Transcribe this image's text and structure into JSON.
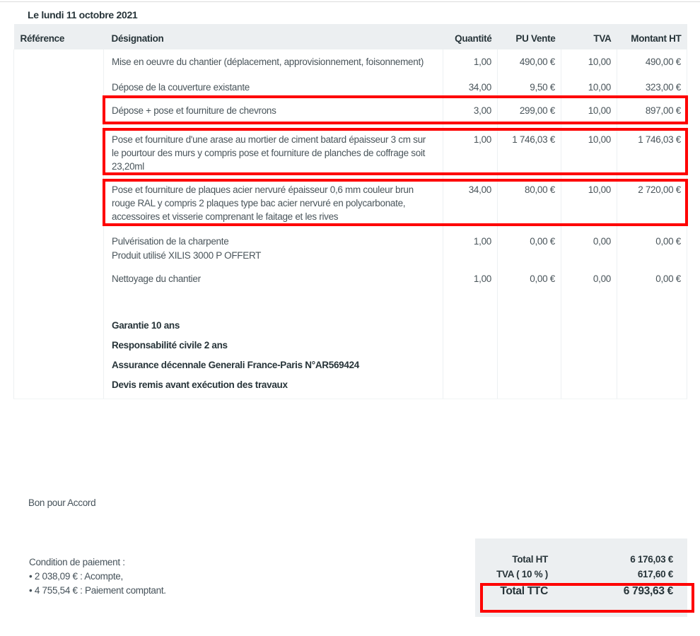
{
  "date_line": "Le lundi 11 octobre 2021",
  "highlight_color": "#ff0000",
  "table": {
    "headers": [
      "Référence",
      "Désignation",
      "Quantité",
      "PU Vente",
      "TVA",
      "Montant HT"
    ],
    "rows": [
      {
        "reference": "",
        "designation_lines": [
          "Mise en oeuvre du chantier (déplacement, approvisionnement, foisonnement)"
        ],
        "quantity": "1,00",
        "unit_price": "490,00 €",
        "tva": "10,00",
        "amount": "490,00 €",
        "highlighted": false
      },
      {
        "reference": "",
        "designation_lines": [
          "Dépose de la couverture existante"
        ],
        "quantity": "34,00",
        "unit_price": "9,50 €",
        "tva": "10,00",
        "amount": "323,00 €",
        "highlighted": false
      },
      {
        "reference": "",
        "designation_lines": [
          "Dépose + pose et fourniture de chevrons"
        ],
        "quantity": "3,00",
        "unit_price": "299,00 €",
        "tva": "10,00",
        "amount": "897,00 €",
        "highlighted": true
      },
      {
        "reference": "",
        "designation_lines": [
          "Pose et fourniture d'une arase au mortier de ciment batard épaisseur 3 cm sur",
          "le pourtour des murs y compris pose et fourniture de planches de coffrage soit",
          "23,20ml"
        ],
        "quantity": "1,00",
        "unit_price": "1 746,03 €",
        "tva": "10,00",
        "amount": "1 746,03 €",
        "highlighted": true
      },
      {
        "reference": "",
        "designation_lines": [
          "Pose et fourniture de plaques acier nervuré épaisseur 0,6 mm couleur brun",
          "rouge RAL y compris 2 plaques type bac acier nervuré en polycarbonate,",
          "accessoires et visserie comprenant le faitage et les rives"
        ],
        "quantity": "34,00",
        "unit_price": "80,00 €",
        "tva": "10,00",
        "amount": "2 720,00 €",
        "highlighted": true
      },
      {
        "reference": "",
        "designation_lines": [
          "Pulvérisation de la charpente",
          "Produit utilisé XILIS 3000 P OFFERT"
        ],
        "quantity": "1,00",
        "unit_price": "0,00 €",
        "tva": "0,00",
        "amount": "0,00 €",
        "highlighted": false
      },
      {
        "reference": "",
        "designation_lines": [
          "Nettoyage du chantier"
        ],
        "quantity": "1,00",
        "unit_price": "0,00 €",
        "tva": "0,00",
        "amount": "0,00 €",
        "highlighted": false
      }
    ],
    "notes": [
      "Garantie 10 ans",
      "Responsabilité civile 2 ans",
      "Assurance décennale Generali France-Paris N°AR569424",
      "Devis remis avant exécution des travaux"
    ]
  },
  "approval_text": "Bon pour Accord",
  "payment": {
    "title": "Condition de paiement :",
    "items": [
      "2 038,09 € : Acompte,",
      "4 755,54 € : Paiement comptant."
    ]
  },
  "totals": {
    "rows": [
      {
        "label": "Total HT",
        "value": "6 176,03 €",
        "highlighted": false
      },
      {
        "label": "TVA ( 10 % )",
        "value": "617,60 €",
        "highlighted": false
      },
      {
        "label": "Total TTC",
        "value": "6 793,63 €",
        "highlighted": true
      }
    ]
  }
}
